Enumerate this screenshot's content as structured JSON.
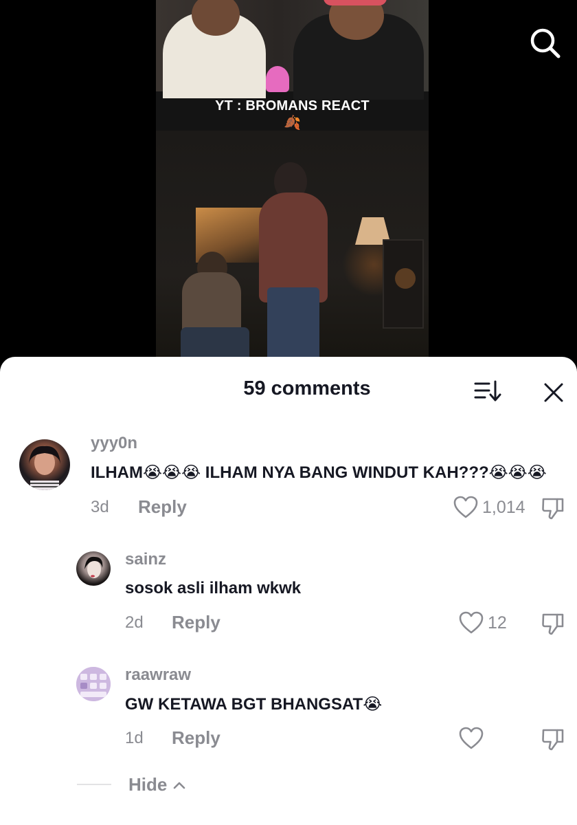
{
  "video": {
    "overlay_title": "YT : BROMANS REACT",
    "overlay_emoji": "🍂"
  },
  "comments_panel": {
    "title": "59 comments"
  },
  "comments": [
    {
      "username": "yyy0n",
      "text": "ILHAM😭😭😭 ILHAM NYA BANG WINDUT KAH???😭😭😭",
      "time": "3d",
      "reply_label": "Reply",
      "likes": "1,014"
    },
    {
      "username": "sainz",
      "text": "sosok asli ilham wkwk",
      "time": "2d",
      "reply_label": "Reply",
      "likes": "12"
    },
    {
      "username": "raawraw",
      "text": "GW KETAWA BGT BHANGSAT😭",
      "time": "1d",
      "reply_label": "Reply",
      "likes": ""
    }
  ],
  "hide_label": "Hide",
  "hide_icon": "chevron-up-icon",
  "colors": {
    "sheet_bg": "#ffffff",
    "primary_text": "#161823",
    "secondary_text": "#8a8b91",
    "video_bg": "#000000"
  }
}
